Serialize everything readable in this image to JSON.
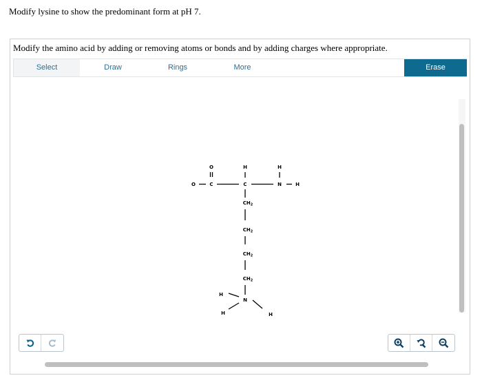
{
  "question": "Modify lysine to show the predominant form at pH 7.",
  "instruction": "Modify the amino acid by adding or removing atoms or bonds and by adding charges where appropriate.",
  "toolbar": {
    "select": "Select",
    "draw": "Draw",
    "rings": "Rings",
    "more": "More",
    "erase": "Erase"
  },
  "controls": {
    "undo_icon": "undo-icon",
    "redo_icon": "redo-icon",
    "zoom_in_icon": "zoom-in-icon",
    "reset_zoom_icon": "reset-zoom-icon",
    "zoom_out_icon": "zoom-out-icon"
  },
  "molecule": {
    "carbonyl_o": "O",
    "carboxyl_o": "O",
    "carboxyl_c": "C",
    "alpha_h": "H",
    "alpha_c": "C",
    "amine_h_top": "H",
    "amine_n": "N",
    "amine_h_right": "H",
    "ch2_1": "CH",
    "ch2_2": "CH",
    "ch2_3": "CH",
    "ch2_4": "CH",
    "sub": "2",
    "side_n": "N",
    "side_h_left_top": "H",
    "side_h_left_bottom": "H",
    "side_h_right": "H"
  },
  "colors": {
    "accent": "#0e6a8e",
    "tool_text": "#2a6f95"
  }
}
